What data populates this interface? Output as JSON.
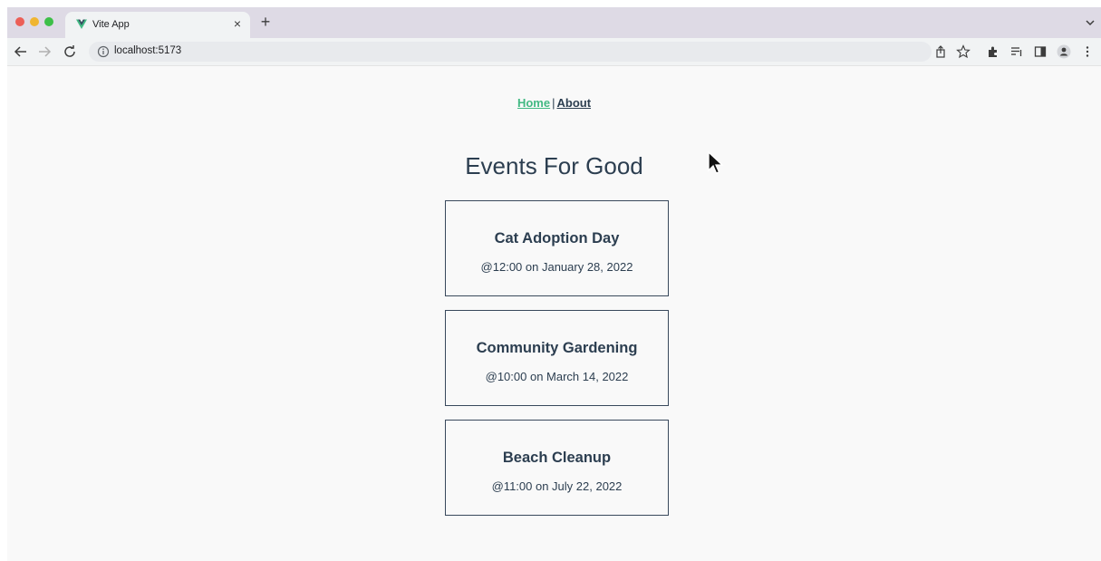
{
  "browser": {
    "tab": {
      "title": "Vite App",
      "close_label": "×"
    },
    "new_tab_label": "+",
    "address": {
      "url": "localhost:5173"
    },
    "icons": [
      "vue-favicon-icon",
      "back-icon",
      "forward-icon",
      "reload-icon",
      "info-icon",
      "share-icon",
      "star-icon",
      "extensions-icon",
      "reading-list-icon",
      "side-panel-icon",
      "profile-icon",
      "menu-icon",
      "tab-search-icon"
    ]
  },
  "nav": {
    "home_label": "Home",
    "separator": "|",
    "about_label": "About"
  },
  "page": {
    "title": "Events For Good"
  },
  "events": [
    {
      "title": "Cat Adoption Day",
      "date": "@12:00 on January 28, 2022"
    },
    {
      "title": "Community Gardening",
      "date": "@10:00 on March 14, 2022"
    },
    {
      "title": "Beach Cleanup",
      "date": "@11:00 on July 22, 2022"
    }
  ],
  "colors": {
    "accent": "#42b983",
    "text": "#2c3e50",
    "card_border": "#39495c",
    "background": "#f9f9f9"
  }
}
